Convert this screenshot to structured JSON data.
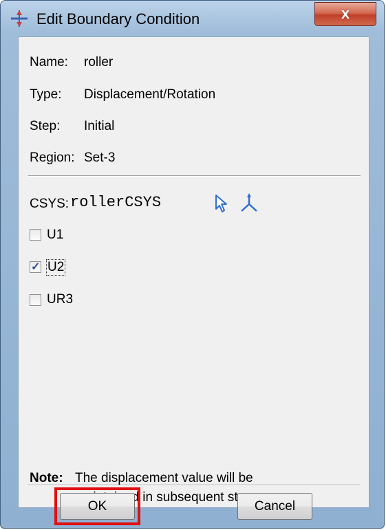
{
  "window": {
    "title": "Edit Boundary Condition",
    "close_glyph": "x"
  },
  "fields": [
    {
      "label": "Name:",
      "value": "roller"
    },
    {
      "label": "Type:",
      "value": "Displacement/Rotation"
    },
    {
      "label": "Step:",
      "value": "Initial"
    },
    {
      "label": "Region:",
      "value": "Set-3"
    }
  ],
  "csys": {
    "label": "CSYS:",
    "value": "rollerCSYS",
    "icons": [
      "select-arrow-icon",
      "coordinate-system-icon"
    ]
  },
  "dofs": [
    {
      "label": "U1",
      "checked": false
    },
    {
      "label": "U2",
      "checked": true
    },
    {
      "label": "UR3",
      "checked": false
    }
  ],
  "note": {
    "label": "Note:",
    "line1": "The displacement value will be",
    "line2": "maintained in subsequent steps."
  },
  "buttons": {
    "ok": "OK",
    "cancel": "Cancel"
  },
  "colors": {
    "highlight": "#e01010",
    "icon_blue": "#2f6fd0"
  }
}
